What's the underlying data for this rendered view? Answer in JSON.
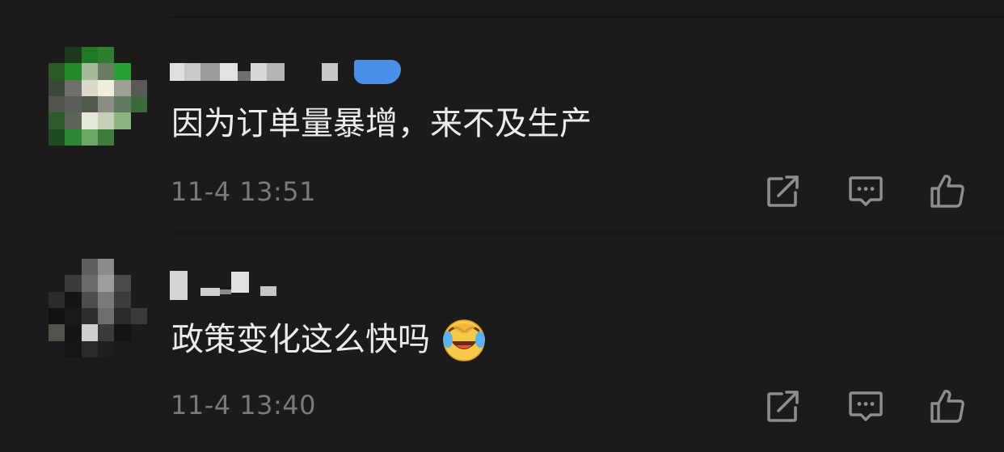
{
  "comments": [
    {
      "text": "因为订单量暴增，来不及生产",
      "timestamp": "11-4 13:51"
    },
    {
      "text": "政策变化这么快吗",
      "emoji": "laughing-crying-emoji",
      "timestamp": "11-4 13:40"
    }
  ],
  "icons": {
    "share": "share-icon",
    "reply": "comment-icon",
    "like": "thumbs-up-icon"
  },
  "colors": {
    "background": "#1b1b1c",
    "text": "#ececec",
    "timestamp": "#7a7a7c",
    "icon": "#8e8e90",
    "verified_badge": "#4a8fe8"
  }
}
